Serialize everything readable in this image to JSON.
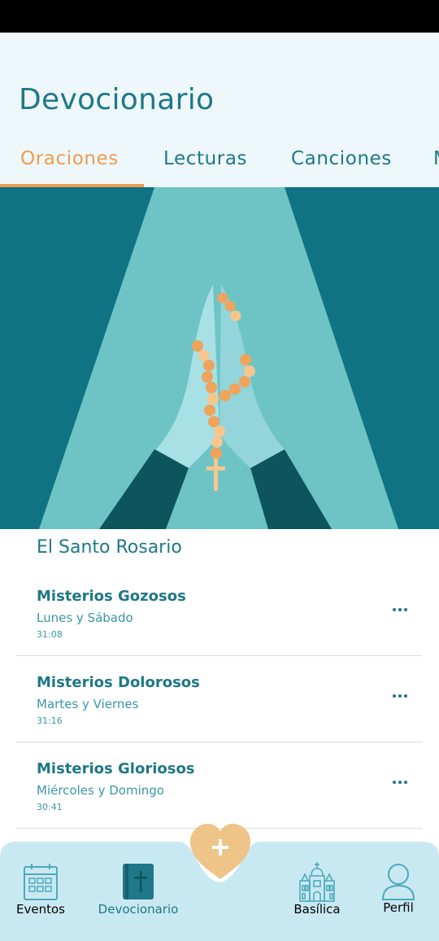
{
  "app": {
    "title": "Devocionario"
  },
  "tabs": [
    {
      "label": "Oraciones",
      "active": true
    },
    {
      "label": "Lecturas",
      "active": false
    },
    {
      "label": "Canciones",
      "active": false
    },
    {
      "label": "M",
      "active": false
    }
  ],
  "section": {
    "title": "El Santo Rosario"
  },
  "items": [
    {
      "title": "Misterios Gozosos",
      "days": "Lunes y Sábado",
      "duration": "31:08"
    },
    {
      "title": "Misterios Dolorosos",
      "days": "Martes y Viernes",
      "duration": "31:16"
    },
    {
      "title": "Misterios Gloriosos",
      "days": "Miércoles y Domingo",
      "duration": "30:41"
    }
  ],
  "bottom_nav": {
    "items": [
      {
        "label": "Eventos",
        "icon": "calendar-icon",
        "active": false
      },
      {
        "label": "Devocionario",
        "icon": "bible-icon",
        "active": true
      },
      {
        "label": "Basílica",
        "icon": "basilica-icon",
        "active": false
      },
      {
        "label": "Perfil",
        "icon": "person-icon",
        "active": false
      }
    ],
    "fab_icon": "plus-heart-icon"
  },
  "colors": {
    "primary": "#1f7887",
    "accent": "#ef9b4c",
    "header_bg": "#eef8fb",
    "hero_bg": "#0f7383",
    "nav_bg": "#c9e9f2"
  }
}
